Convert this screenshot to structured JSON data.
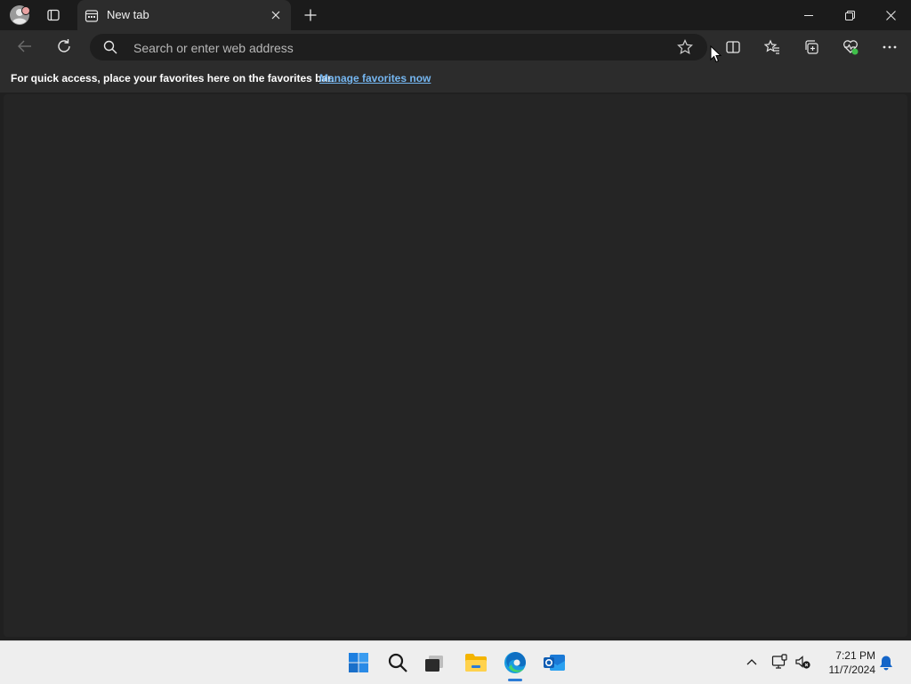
{
  "tab": {
    "title": "New tab"
  },
  "address_bar": {
    "placeholder": "Search or enter web address",
    "value": ""
  },
  "favorites_bar": {
    "message": "For quick access, place your favorites here on the favorites bar.",
    "link_label": "Manage favorites now"
  },
  "clock": {
    "time": "7:21 PM",
    "date": "11/7/2024"
  },
  "colors": {
    "titlebar": "#1b1b1b",
    "toolbar": "#2c2c2c",
    "content": "#252525",
    "link": "#75b6f0",
    "taskbar": "#eeeeee",
    "accent": "#2b7bd6"
  },
  "icons": {
    "profile": "profile-avatar-icon",
    "tab_actions": "tab-actions-icon",
    "tab_favicon": "new-tab-page-icon",
    "tab_close": "close-icon",
    "new_tab": "plus-icon",
    "minimize": "minimize-icon",
    "restore": "restore-icon",
    "close": "close-icon",
    "back": "arrow-left-icon",
    "refresh": "refresh-icon",
    "search": "search-icon",
    "favorite": "star-icon",
    "split_screen": "split-screen-icon",
    "favorites": "favorites-icon",
    "collections": "collections-icon",
    "browser_essentials": "heart-pulse-icon",
    "more": "more-icon",
    "taskbar_start": "windows-start-icon",
    "taskbar_search": "search-icon",
    "taskbar_taskview": "task-view-icon",
    "taskbar_explorer": "folder-icon",
    "taskbar_edge": "edge-icon",
    "taskbar_outlook": "outlook-icon",
    "tray_overflow": "chevron-up-icon",
    "tray_network": "network-icon",
    "tray_volume": "volume-mute-icon",
    "notifications": "bell-icon"
  }
}
